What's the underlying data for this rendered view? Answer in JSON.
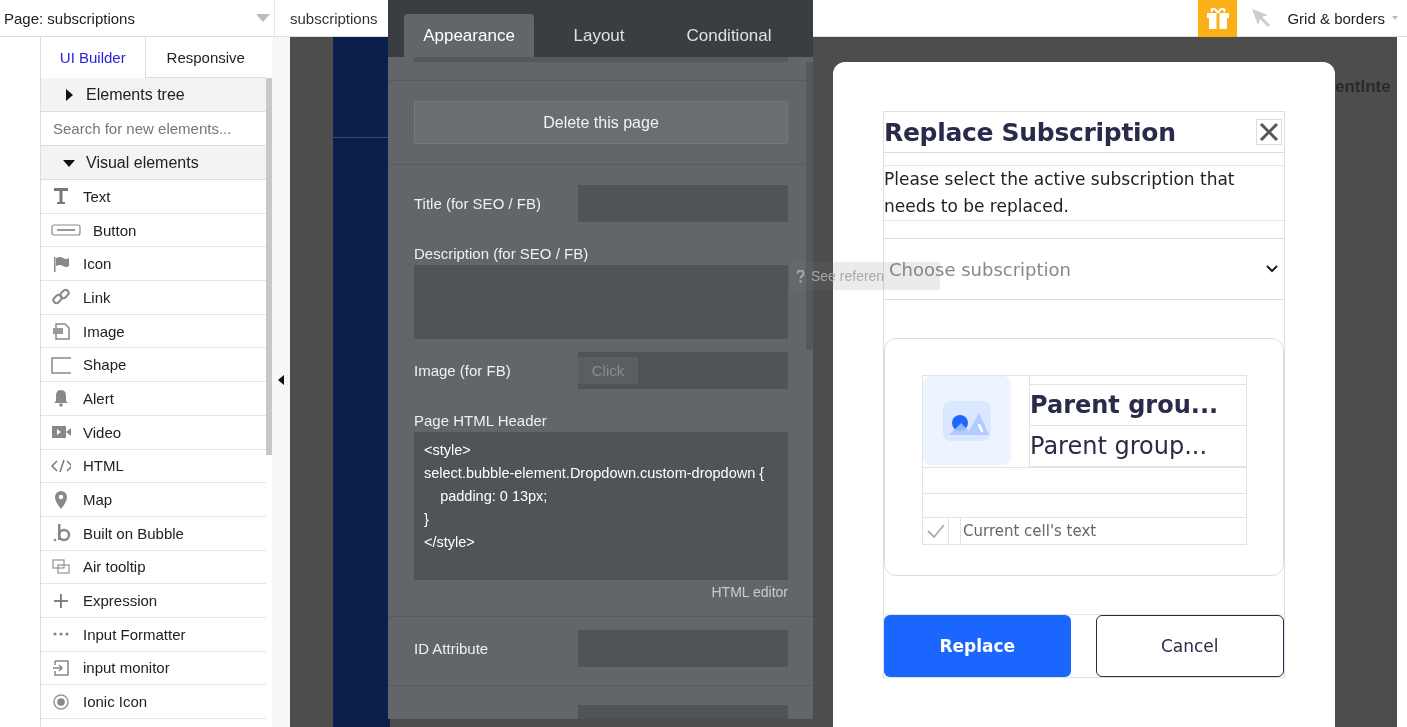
{
  "top_bar": {
    "page_selector": "Page: subscriptions",
    "page_name": "subscriptions",
    "view_menu": "Grid & borders"
  },
  "sidebar": {
    "tabs": [
      {
        "label": "UI Builder",
        "selected": true
      },
      {
        "label": "Responsive",
        "selected": false
      }
    ],
    "elements_tree": {
      "label": "Elements tree",
      "expanded": false
    },
    "search": {
      "placeholder": "Search for new elements..."
    },
    "visual_elements": {
      "label": "Visual elements",
      "expanded": true,
      "items": [
        {
          "label": "Text"
        },
        {
          "label": "Button"
        },
        {
          "label": "Icon"
        },
        {
          "label": "Link"
        },
        {
          "label": "Image"
        },
        {
          "label": "Shape"
        },
        {
          "label": "Alert"
        },
        {
          "label": "Video"
        },
        {
          "label": "HTML"
        },
        {
          "label": "Map"
        },
        {
          "label": "Built on Bubble"
        },
        {
          "label": "Air tooltip"
        },
        {
          "label": "Expression"
        },
        {
          "label": "Input Formatter"
        },
        {
          "label": "input monitor"
        },
        {
          "label": "Ionic Icon"
        }
      ]
    }
  },
  "canvas": {
    "partial_text": "entInte",
    "tooltip": "See referen"
  },
  "property_panel": {
    "tabs": [
      {
        "label": "Appearance",
        "selected": true
      },
      {
        "label": "Layout",
        "selected": false
      },
      {
        "label": "Conditional",
        "selected": false
      }
    ],
    "delete_button": "Delete this page",
    "fields": [
      {
        "kind": "input",
        "label": "Title (for SEO / FB)"
      },
      {
        "kind": "textarea",
        "label": "Description (for SEO / FB)"
      },
      {
        "kind": "image",
        "label": "Image (for FB)",
        "button": "Click"
      },
      {
        "kind": "code",
        "label": "Page HTML Header",
        "value": "<style>\nselect.bubble-element.Dropdown.custom-dropdown {\n    padding: 0 13px;\n}\n</style>",
        "link": "HTML editor"
      },
      {
        "kind": "input",
        "label": "ID Attribute"
      }
    ]
  },
  "modal": {
    "title": "Replace Subscription",
    "description": "Please select the active subscription that needs to be replaced.",
    "dropdown": {
      "placeholder": "Choose subscription"
    },
    "card": {
      "title": "Parent grou...",
      "subtitle": "Parent group...",
      "checkbox": {
        "checked": true,
        "label": "Current cell's text"
      }
    },
    "buttons": [
      {
        "kind": "primary",
        "label": "Replace"
      },
      {
        "kind": "secondary",
        "label": "Cancel"
      }
    ]
  }
}
